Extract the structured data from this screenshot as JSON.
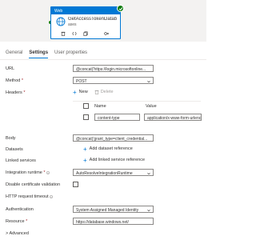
{
  "activity": {
    "type_label": "Web",
    "name": "GetAccessTokenDatab",
    "name_cont": "ases"
  },
  "tabs": [
    {
      "label": "General"
    },
    {
      "label": "Settings"
    },
    {
      "label": "User properties"
    }
  ],
  "form": {
    "url_label": "URL",
    "url_value": "@concat('https://login.microsoftonline...",
    "method_label": "Method",
    "method_value": "POST",
    "headers_label": "Headers",
    "new_label": "New",
    "delete_label": "Delete",
    "col_name": "Name",
    "col_value": "Value",
    "header_name": "content-type",
    "header_value": "application/x-www-form-urlencoded",
    "body_label": "Body",
    "body_value": "@concat('grant_type=client_credential...",
    "datasets_label": "Datasets",
    "add_dataset_label": "Add dataset reference",
    "linked_label": "Linked services",
    "add_linked_label": "Add linked service reference",
    "ir_label": "Integration runtime",
    "ir_value": "AutoResolveIntegrationRuntime",
    "cert_label": "Disable certificate validation",
    "timeout_label": "HTTP request timeout",
    "auth_label": "Authentication",
    "auth_value": "System Assigned Managed Identity",
    "resource_label": "Resource",
    "resource_value": "https://database.windows.net/",
    "advanced_label": "Advanced",
    "required_mark": "*"
  },
  "colors": {
    "accent": "#0078d4",
    "success": "#107c10",
    "required": "#a4262c"
  }
}
